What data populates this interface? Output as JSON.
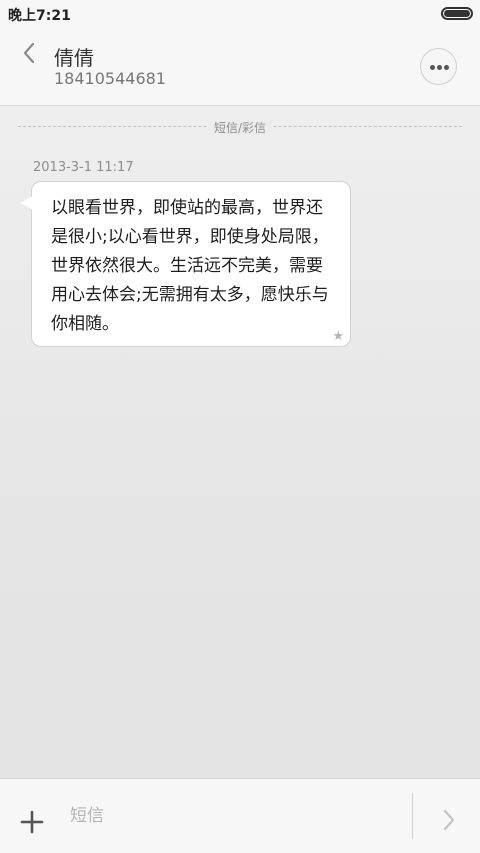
{
  "status_bar": {
    "time": "晚上7:21"
  },
  "header": {
    "contact_name": "倩倩",
    "contact_number": "18410544681"
  },
  "thread": {
    "divider_label": "短信/彩信",
    "messages": [
      {
        "timestamp": "2013-3-1 11:17",
        "text": "以眼看世界，即使站的最高，世界还是很小;以心看世界，即使身处局限，世界依然很大。生活远不完美，需要用心去体会;无需拥有太多，愿快乐与你相随。",
        "starred": true
      }
    ]
  },
  "composer": {
    "placeholder": "短信",
    "value": ""
  },
  "icons": {
    "back": "chevron-left-icon",
    "more": "more-dots-icon",
    "star": "star-icon",
    "attach": "plus-icon",
    "send": "chevron-right-icon"
  },
  "colors": {
    "background": "#e6e6e6",
    "bubble": "#ffffff",
    "text": "#1e1e1e",
    "secondary_text": "#8d8d8d"
  }
}
